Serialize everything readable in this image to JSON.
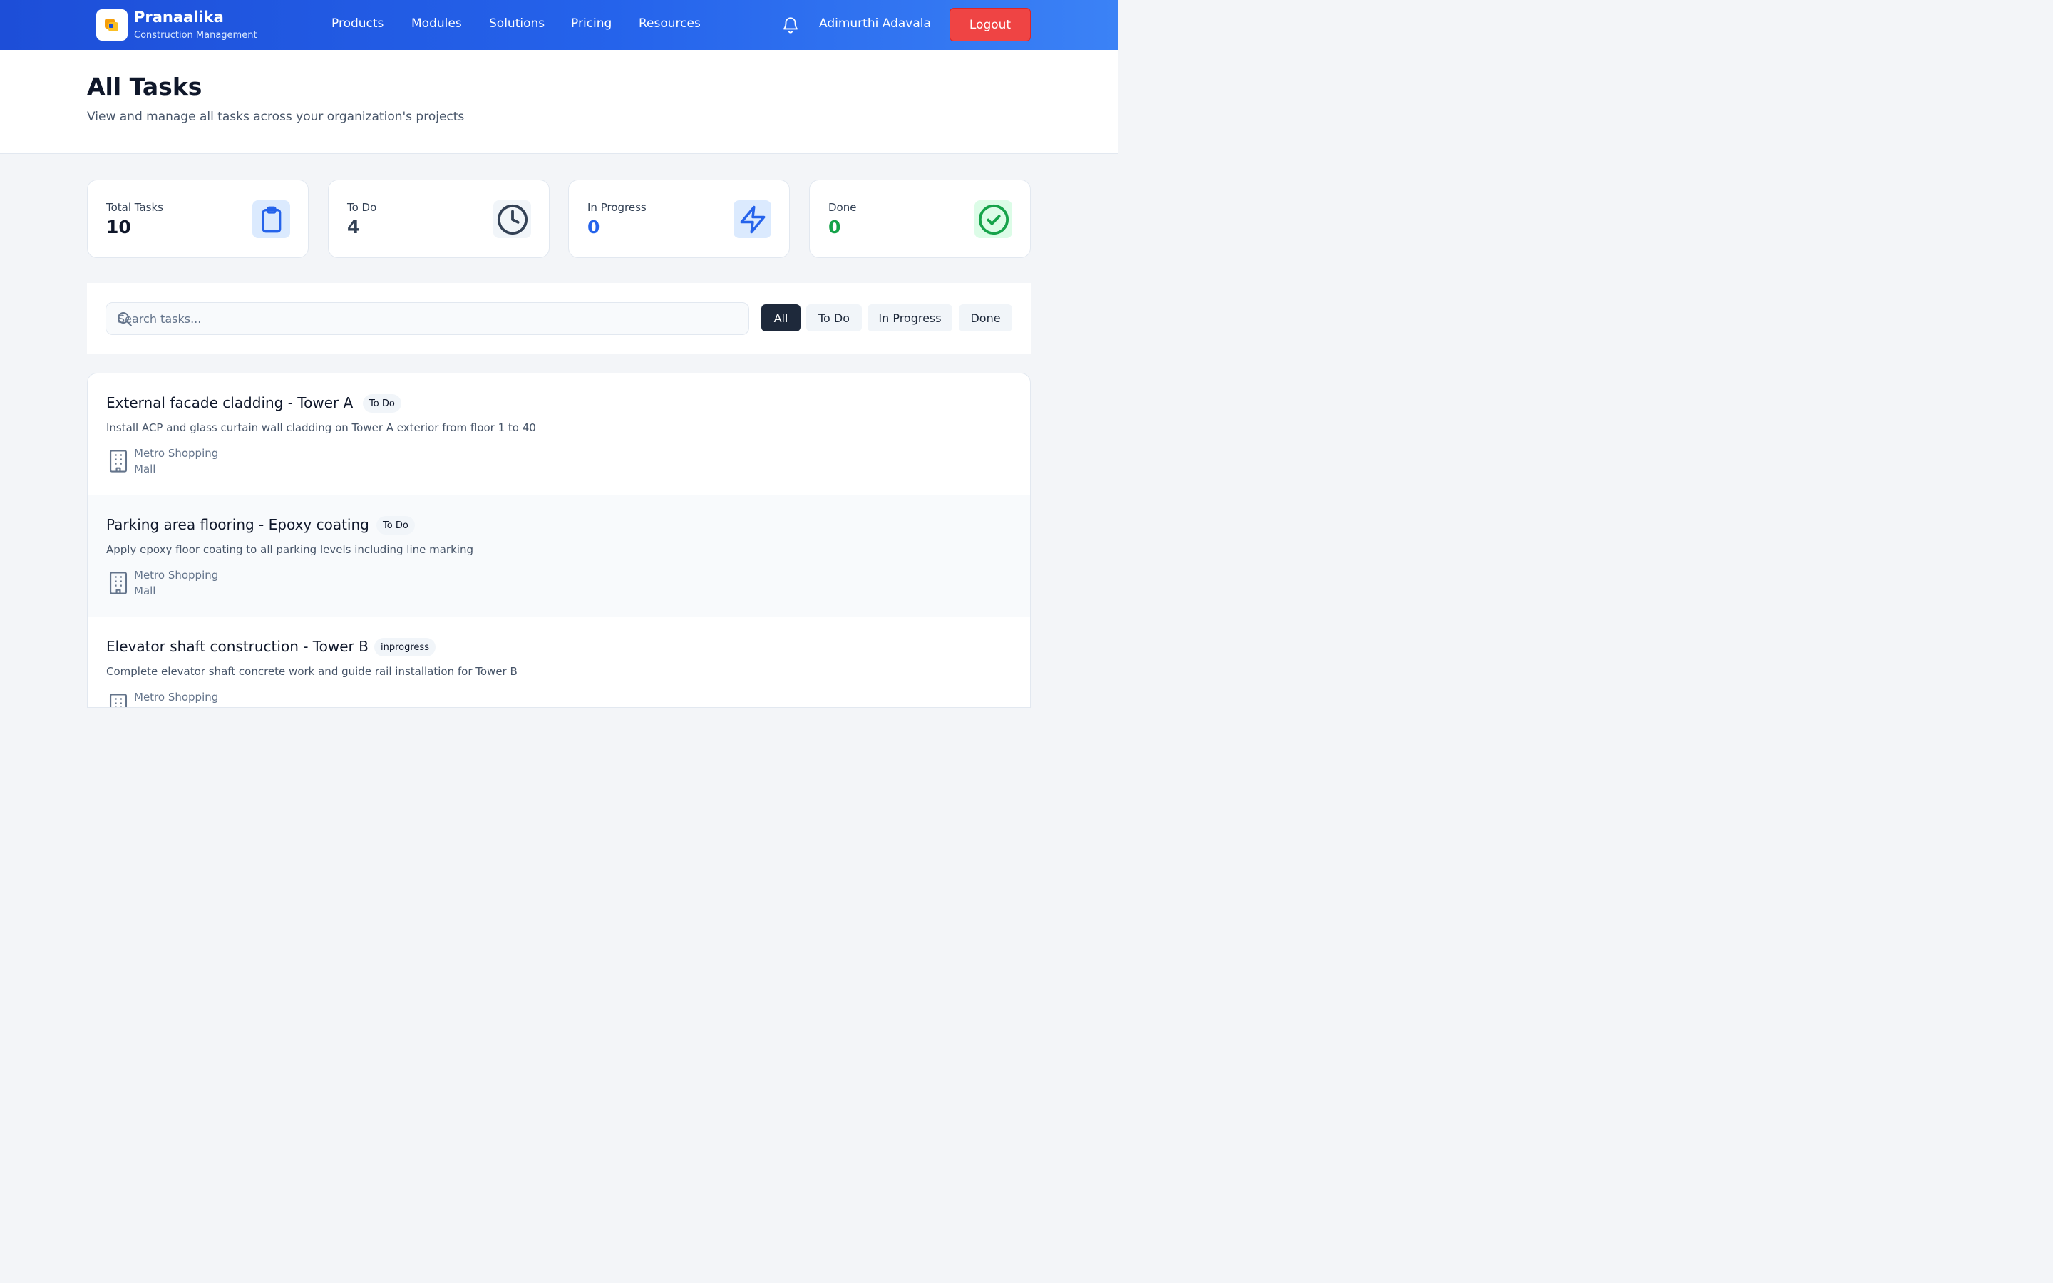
{
  "brand": {
    "name": "Pranaalika",
    "subtitle": "Construction Management"
  },
  "nav": {
    "items": [
      {
        "label": "Products"
      },
      {
        "label": "Modules"
      },
      {
        "label": "Solutions"
      },
      {
        "label": "Pricing"
      },
      {
        "label": "Resources"
      }
    ]
  },
  "user": {
    "name": "Adimurthi Adavala",
    "logout_label": "Logout"
  },
  "page": {
    "title": "All Tasks",
    "subtitle": "View and manage all tasks across your organization's projects"
  },
  "stats": [
    {
      "label": "Total Tasks",
      "value": "10",
      "icon": "clipboard-icon",
      "color": "#0f172a"
    },
    {
      "label": "To Do",
      "value": "4",
      "icon": "clock-icon",
      "color": "#334155"
    },
    {
      "label": "In Progress",
      "value": "0",
      "icon": "lightning-icon",
      "color": "#2563eb"
    },
    {
      "label": "Done",
      "value": "0",
      "icon": "check-circle-icon",
      "color": "#16a34a"
    }
  ],
  "search": {
    "placeholder": "Search tasks..."
  },
  "filters": [
    {
      "label": "All",
      "active": true
    },
    {
      "label": "To Do",
      "active": false
    },
    {
      "label": "In Progress",
      "active": false
    },
    {
      "label": "Done",
      "active": false
    }
  ],
  "tasks": [
    {
      "title": "External facade cladding - Tower A",
      "status": "To Do",
      "description": "Install ACP and glass curtain wall cladding on Tower A exterior from floor 1 to 40",
      "project": "Metro Shopping Mall"
    },
    {
      "title": "Parking area flooring - Epoxy coating",
      "status": "To Do",
      "description": "Apply epoxy floor coating to all parking levels including line marking",
      "project": "Metro Shopping Mall"
    },
    {
      "title": "Elevator shaft construction - Tower B",
      "status": "inprogress",
      "description": "Complete elevator shaft concrete work and guide rail installation for Tower B",
      "project": "Metro Shopping Mall"
    }
  ],
  "colors": {
    "primary": "#2563eb",
    "logout": "#ef4444",
    "active_chip": "#1e293b",
    "success": "#16a34a"
  }
}
